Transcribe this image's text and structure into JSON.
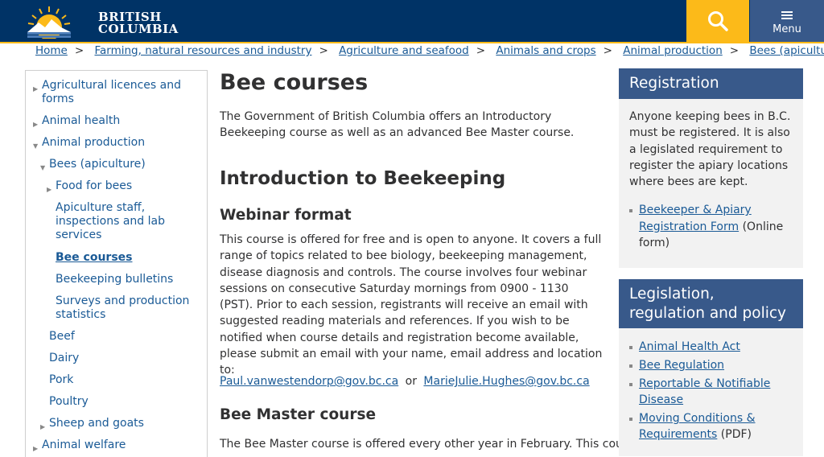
{
  "header": {
    "logo_line1": "BRITISH",
    "logo_line2": "COLUMBIA",
    "menu_label": "Menu"
  },
  "breadcrumb": [
    "Home",
    "Farming, natural resources and industry",
    "Agriculture and seafood",
    "Animals and crops",
    "Animal production",
    "Bees (apiculture)"
  ],
  "sidebar": {
    "items": [
      {
        "label": "Agricultural licences and forms"
      },
      {
        "label": "Animal health"
      },
      {
        "label": "Animal production"
      },
      {
        "label": "Bees (apiculture)"
      },
      {
        "label": "Food for bees"
      },
      {
        "label": "Apiculture staff, inspections and lab services"
      },
      {
        "label": "Bee courses"
      },
      {
        "label": "Beekeeping bulletins"
      },
      {
        "label": "Surveys and production statistics"
      },
      {
        "label": "Beef"
      },
      {
        "label": "Dairy"
      },
      {
        "label": "Pork"
      },
      {
        "label": "Poultry"
      },
      {
        "label": "Sheep and goats"
      },
      {
        "label": "Animal welfare"
      }
    ]
  },
  "main": {
    "title": "Bee courses",
    "intro": "The Government of British Columbia offers an Introductory Beekeeping course as well as an advanced Bee Master course.",
    "section1_title": "Introduction to Beekeeping",
    "webinar_title": "Webinar format",
    "webinar_text": "This course is offered for free and is open to anyone. It covers a full range of topics related to bee biology, beekeeping management, disease diagnosis and controls. The course involves four webinar sessions on consecutive Saturday mornings from 0900 - 1130 (PST). Prior to each session, registrants will receive an email with suggested reading materials and references. If you wish to be notified when course details and registration become available, please submit an email with your name, email address and location to:",
    "email1": "Paul.vanwestendorp@gov.bc.ca",
    "email_or": "or",
    "email2": "MarieJulie.Hughes@gov.bc.ca",
    "bee_master_title": "Bee Master course",
    "bee_master_text": "The Bee Master course is offered every other year in February. This course"
  },
  "registration": {
    "title": "Registration",
    "text": "Anyone keeping bees in B.C. must be registered. It is also a legislated requirement to register the apiary locations where bees are kept.",
    "link": "Beekeeper & Apiary Registration Form",
    "link_suffix": " (Online form)"
  },
  "legislation": {
    "title": "Legislation, regulation and policy",
    "links": [
      {
        "label": "Animal Health Act",
        "suffix": ""
      },
      {
        "label": "Bee Regulation",
        "suffix": ""
      },
      {
        "label": "Reportable & Notifiable Disease",
        "suffix": ""
      },
      {
        "label": "Moving Conditions & Requirements",
        "suffix": " (PDF)"
      }
    ]
  },
  "colors": {
    "header_bg": "#003366",
    "accent_gold": "#fcba19",
    "menu_bg": "#38598a",
    "link": "#1a5a96"
  }
}
